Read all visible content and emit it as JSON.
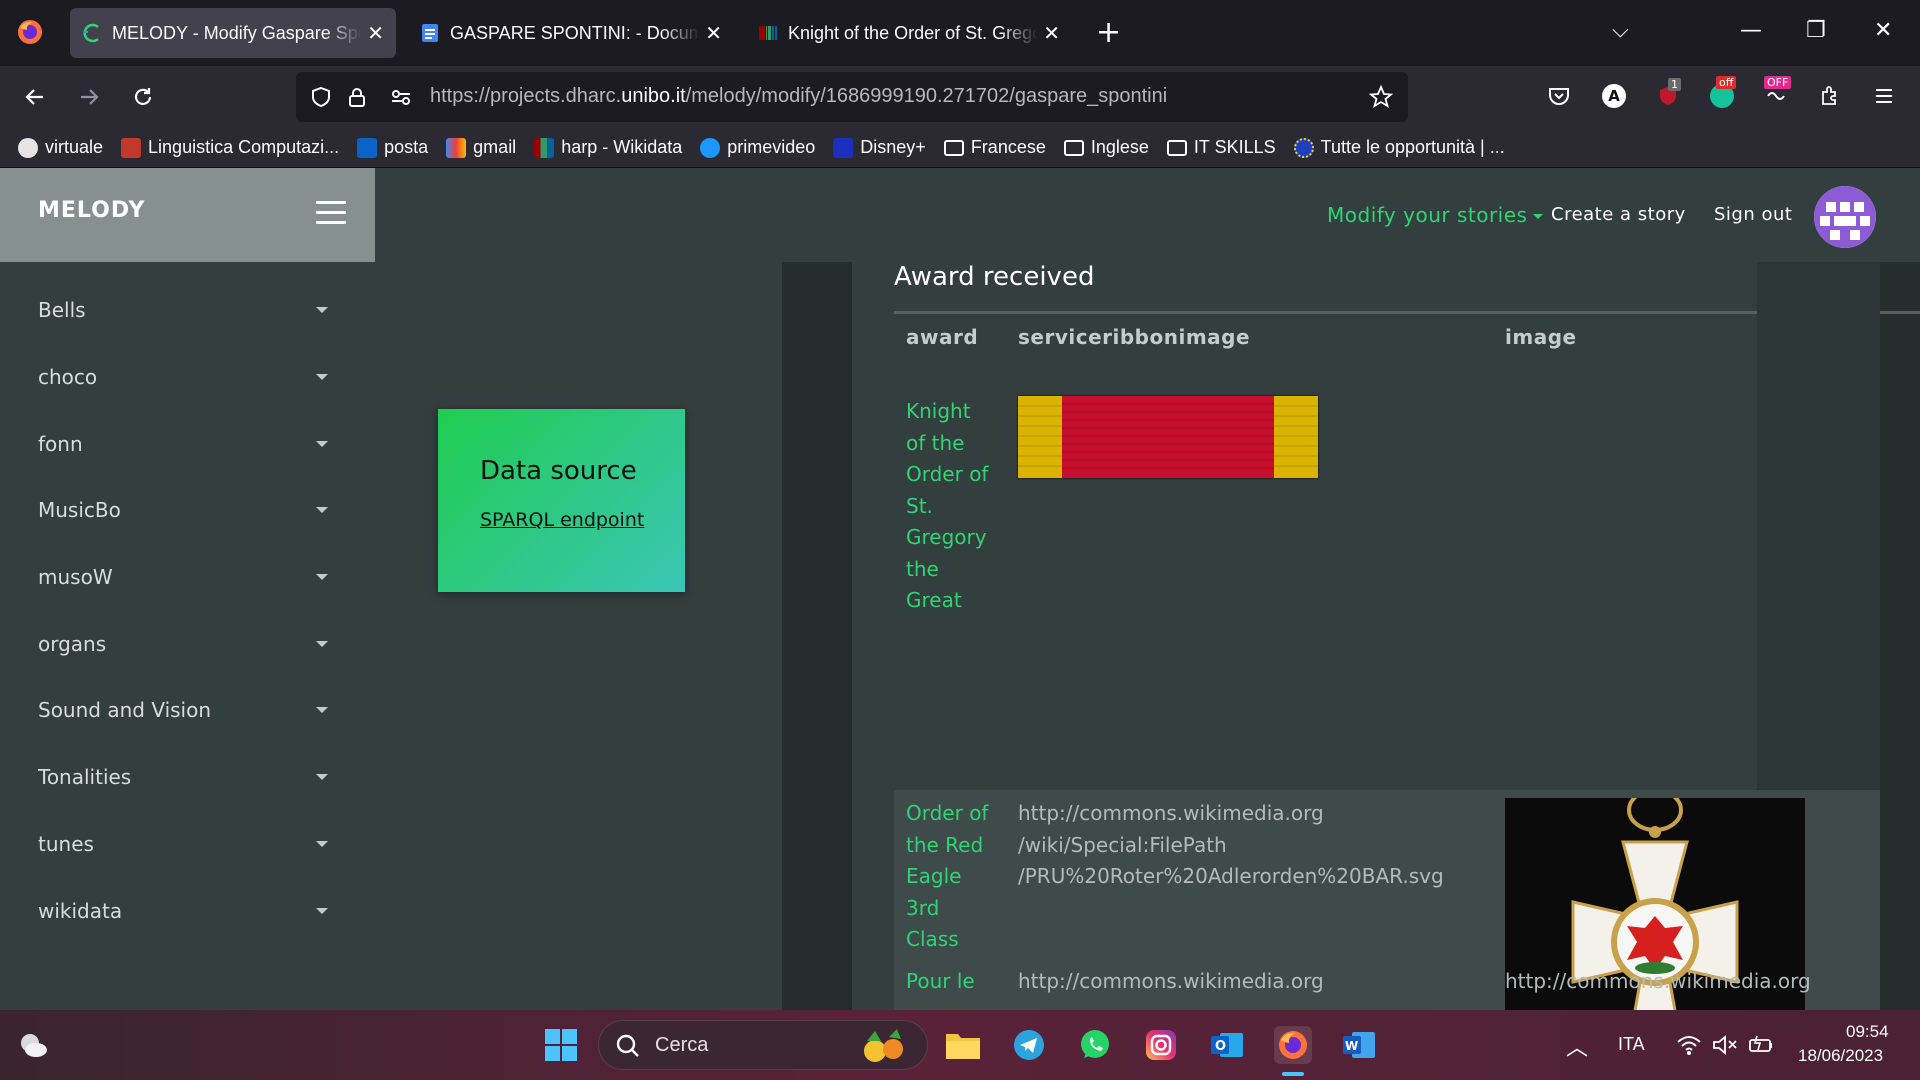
{
  "browser": {
    "tabs": [
      {
        "title": "MELODY - Modify Gaspare Spontini",
        "active": true
      },
      {
        "title": "GASPARE SPONTINI: - Documenti Google",
        "active": false
      },
      {
        "title": "Knight of the Order of St. Gregory the Great",
        "active": false
      }
    ],
    "url_prefix": "https://projects.dharc.",
    "url_domain": "unibo.it",
    "url_suffix": "/melody/modify/1686999190.271702/gaspare_spontini",
    "extension_badges": {
      "ublock": "1",
      "off1": "off",
      "off2": "OFF"
    },
    "bookmarks": [
      {
        "label": "virtuale",
        "color": "#e8e4e4"
      },
      {
        "label": "Linguistica Computazi...",
        "color": "#c0392b"
      },
      {
        "label": "posta",
        "color": "#0a64c8"
      },
      {
        "label": "gmail",
        "color": "#ea4335"
      },
      {
        "label": "harp - Wikidata",
        "color": "#990000"
      },
      {
        "label": "primevideo",
        "color": "#1a98ff"
      },
      {
        "label": "Disney+",
        "color": "#1b2fbf"
      },
      {
        "label": "Francese",
        "color": "folder"
      },
      {
        "label": "Inglese",
        "color": "folder"
      },
      {
        "label": "IT SKILLS",
        "color": "folder"
      },
      {
        "label": "Tutte le opportunità | ...",
        "color": "#1f3fbf"
      }
    ]
  },
  "app": {
    "brand": "MELODY",
    "sidebar_items": [
      "Bells",
      "choco",
      "fonn",
      "MusicBo",
      "musoW",
      "organs",
      "Sound and Vision",
      "Tonalities",
      "tunes",
      "wikidata"
    ],
    "topnav": {
      "modify": "Modify your stories",
      "create": "Create a story",
      "signout": "Sign out"
    },
    "data_source": {
      "heading": "Data source",
      "link": "SPARQL endpoint"
    },
    "section": {
      "title": "Award received",
      "columns": [
        "award",
        "serviceribbonimage",
        "image"
      ],
      "rows": [
        {
          "award_lines": [
            "Knight",
            "of the",
            "Order of",
            "St.",
            "Gregory",
            "the",
            "Great"
          ],
          "ribbon_url_lines": [],
          "image_url_lines": []
        },
        {
          "award_lines": [
            "Order of",
            "the Red",
            "Eagle",
            "3rd",
            "Class"
          ],
          "ribbon_url_lines": [
            "http://commons.wikimedia.org",
            "/wiki/Special:FilePath",
            "/PRU%20Roter%20Adlerorden%20BAR.svg"
          ],
          "image_url_lines": []
        },
        {
          "award_lines": [
            "Pour le"
          ],
          "ribbon_url_lines": [
            "http://commons.wikimedia.org"
          ],
          "image_url_lines": [
            "http://commons.wikimedia.org"
          ]
        }
      ]
    }
  },
  "taskbar": {
    "search_label": "Cerca",
    "language": "ITA",
    "time": "09:54",
    "date": "18/06/2023"
  }
}
